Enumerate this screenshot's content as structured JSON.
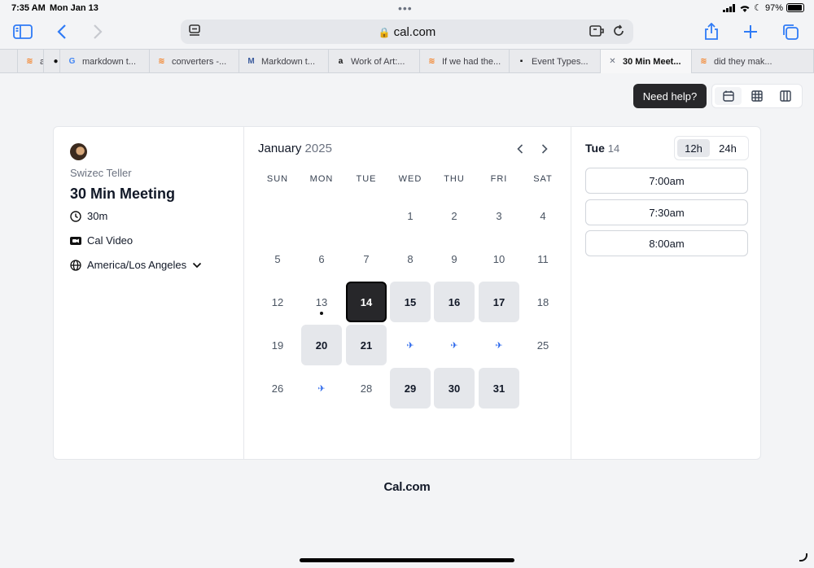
{
  "status_bar": {
    "time": "7:35 AM",
    "date": "Mon Jan 13",
    "battery": "97%"
  },
  "browser": {
    "url": "cal.com",
    "tabs": [
      {
        "label": "",
        "icon": "blank"
      },
      {
        "label": "asciido",
        "icon": "stack-icon"
      },
      {
        "label": "",
        "icon": "github-icon"
      },
      {
        "label": "markdown t...",
        "icon": "google-icon"
      },
      {
        "label": "converters -...",
        "icon": "stack-icon"
      },
      {
        "label": "Markdown t...",
        "icon": "m-icon"
      },
      {
        "label": "Work of Art:...",
        "icon": "amazon-icon"
      },
      {
        "label": "If we had the...",
        "icon": "stack-icon"
      },
      {
        "label": "Event Types...",
        "icon": "cal-icon"
      },
      {
        "label": "30 Min Meet...",
        "icon": "close-icon"
      },
      {
        "label": "did they mak...",
        "icon": "stack-icon"
      }
    ]
  },
  "toolbar": {
    "help_label": "Need help?"
  },
  "event": {
    "host": "Swizec Teller",
    "title": "30 Min Meeting",
    "duration": "30m",
    "location": "Cal Video",
    "timezone": "America/Los Angeles"
  },
  "calendar": {
    "month": "January",
    "year": "2025",
    "weekdays": [
      "SUN",
      "MON",
      "TUE",
      "WED",
      "THU",
      "FRI",
      "SAT"
    ],
    "weeks": [
      [
        {
          "d": ""
        },
        {
          "d": ""
        },
        {
          "d": ""
        },
        {
          "d": "1"
        },
        {
          "d": "2"
        },
        {
          "d": "3"
        },
        {
          "d": "4"
        }
      ],
      [
        {
          "d": "5"
        },
        {
          "d": "6"
        },
        {
          "d": "7"
        },
        {
          "d": "8"
        },
        {
          "d": "9"
        },
        {
          "d": "10"
        },
        {
          "d": "11"
        }
      ],
      [
        {
          "d": "12"
        },
        {
          "d": "13",
          "today": true
        },
        {
          "d": "14",
          "state": "selected"
        },
        {
          "d": "15",
          "state": "available"
        },
        {
          "d": "16",
          "state": "available"
        },
        {
          "d": "17",
          "state": "available"
        },
        {
          "d": "18"
        }
      ],
      [
        {
          "d": "19"
        },
        {
          "d": "20",
          "state": "available"
        },
        {
          "d": "21",
          "state": "available"
        },
        {
          "d": "",
          "icon": "airplane-icon"
        },
        {
          "d": "",
          "icon": "airplane-icon"
        },
        {
          "d": "",
          "icon": "airplane-icon"
        },
        {
          "d": "25"
        }
      ],
      [
        {
          "d": "26"
        },
        {
          "d": "",
          "icon": "airplane-icon"
        },
        {
          "d": "28"
        },
        {
          "d": "29",
          "state": "available"
        },
        {
          "d": "30",
          "state": "available"
        },
        {
          "d": "31",
          "state": "available"
        },
        {
          "d": ""
        }
      ]
    ]
  },
  "slots": {
    "day_name": "Tue",
    "day_num": "14",
    "format_12": "12h",
    "format_24": "24h",
    "times": [
      "7:00am",
      "7:30am",
      "8:00am"
    ]
  },
  "footer": {
    "brand": "Cal.com"
  }
}
